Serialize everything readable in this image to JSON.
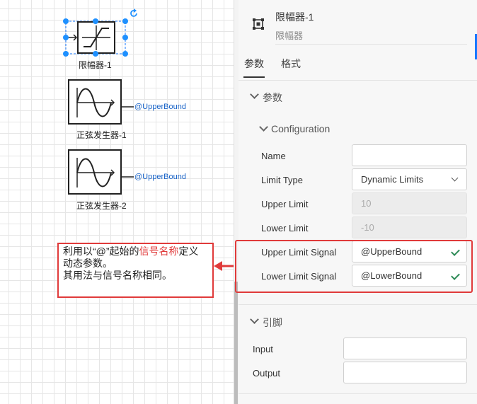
{
  "canvas": {
    "blocks": [
      {
        "label": "限幅器-1"
      },
      {
        "label": "正弦发生器-1",
        "signal": "@UpperBound"
      },
      {
        "label": "正弦发生器-2",
        "signal": "@UpperBound"
      }
    ],
    "annotation": {
      "line1_pre": "利用以“@”起始的",
      "line1_hl": "信号名称",
      "line1_post": "定义动态参数。",
      "line2": "其用法与信号名称相同。"
    }
  },
  "panel": {
    "title": "限幅器-1",
    "subtitle": "限幅器",
    "tabs": [
      "参数",
      "格式"
    ],
    "params_section": "参数",
    "config_section": "Configuration",
    "fields": {
      "name": {
        "label": "Name",
        "value": ""
      },
      "limit_type": {
        "label": "Limit Type",
        "value": "Dynamic Limits"
      },
      "upper_limit": {
        "label": "Upper Limit",
        "value": "10"
      },
      "lower_limit": {
        "label": "Lower Limit",
        "value": "-10"
      },
      "upper_signal": {
        "label": "Upper Limit Signal",
        "value": "@UpperBound"
      },
      "lower_signal": {
        "label": "Lower Limit Signal",
        "value": "@LowerBound"
      }
    },
    "pins_section": "引脚",
    "pins": {
      "input": {
        "label": "Input",
        "value": ""
      },
      "output": {
        "label": "Output",
        "value": ""
      }
    }
  },
  "colors": {
    "accent": "#1677ff",
    "annotation": "#e03a3a",
    "valid": "#2e8b57",
    "signal": "#1a64c8"
  }
}
